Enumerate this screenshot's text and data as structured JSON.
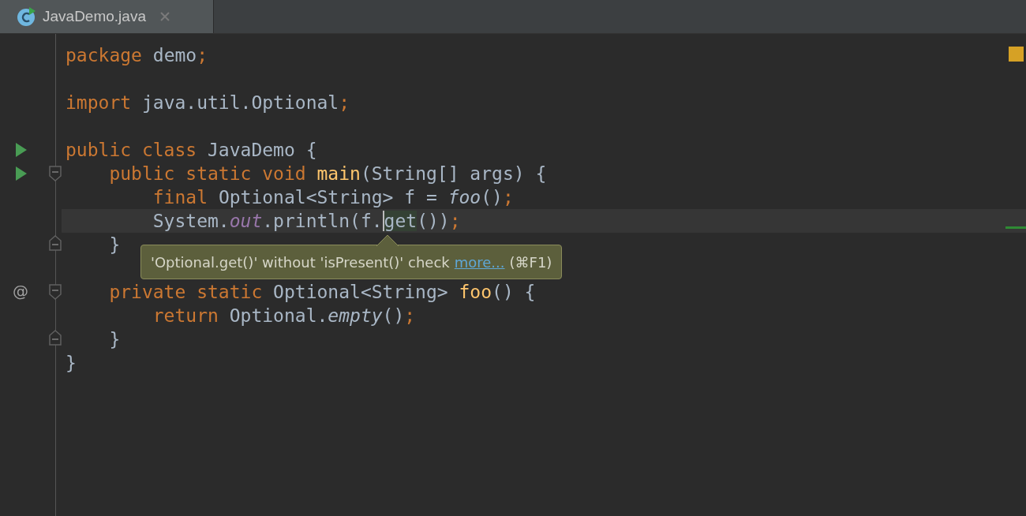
{
  "tab": {
    "title": "JavaDemo.java",
    "selected": true
  },
  "blocks": [
    {
      "lines": [
        {
          "tokens": [
            {
              "kind": "keyword",
              "text": "package "
            },
            {
              "kind": "plain",
              "text": "demo"
            },
            {
              "kind": "punct",
              "text": ";"
            }
          ]
        }
      ]
    },
    {
      "lines": [
        {
          "tokens": [
            {
              "kind": "keyword",
              "text": "import "
            },
            {
              "kind": "plain",
              "text": "java.util.Optional"
            },
            {
              "kind": "punct",
              "text": ";"
            }
          ]
        }
      ]
    },
    {
      "lines": [
        {
          "gutter": [
            {
              "kind": "run"
            }
          ],
          "tokens": [
            {
              "kind": "keyword",
              "text": "public class "
            },
            {
              "kind": "plain",
              "text": "JavaDemo {"
            }
          ]
        },
        {
          "gutter": [
            {
              "kind": "run"
            },
            {
              "kind": "fold-start"
            }
          ],
          "tokens": [
            {
              "kind": "keyword",
              "text": "    public static void "
            },
            {
              "kind": "method",
              "text": "main"
            },
            {
              "kind": "plain",
              "text": "(String[] args) {"
            }
          ]
        },
        {
          "tokens": [
            {
              "kind": "keyword",
              "text": "        final "
            },
            {
              "kind": "plain",
              "text": "Optional<String> f = "
            },
            {
              "kind": "italic",
              "text": "foo"
            },
            {
              "kind": "plain",
              "text": "()"
            },
            {
              "kind": "punct",
              "text": ";"
            }
          ]
        },
        {
          "tokens": [
            {
              "kind": "plain",
              "text": "        System."
            },
            {
              "kind": "field",
              "text": "out"
            },
            {
              "kind": "plain",
              "text": ".println(f."
            },
            {
              "kind": "highlight",
              "text": "get",
              "caret": true
            },
            {
              "kind": "plain",
              "text": "())"
            },
            {
              "kind": "punct",
              "text": ";"
            }
          ]
        },
        {
          "gutter": [
            {
              "kind": "fold-end"
            }
          ],
          "tokens": [
            {
              "kind": "plain",
              "text": "    }"
            }
          ]
        }
      ]
    },
    {
      "lines": [
        {
          "gutter": [
            {
              "kind": "symbol",
              "text": "@"
            },
            {
              "kind": "fold-start"
            }
          ],
          "tokens": [
            {
              "kind": "keyword",
              "text": "    private static "
            },
            {
              "kind": "plain",
              "text": "Optional<String> "
            },
            {
              "kind": "method",
              "text": "foo"
            },
            {
              "kind": "plain",
              "text": "() {"
            }
          ]
        },
        {
          "tokens": [
            {
              "kind": "keyword",
              "text": "        return "
            },
            {
              "kind": "plain",
              "text": "Optional."
            },
            {
              "kind": "italic",
              "text": "empty"
            },
            {
              "kind": "plain",
              "text": "()"
            },
            {
              "kind": "punct",
              "text": ";"
            }
          ]
        },
        {
          "gutter": [
            {
              "kind": "fold-end"
            }
          ],
          "tokens": [
            {
              "kind": "plain",
              "text": "    }"
            }
          ]
        },
        {
          "tokens": [
            {
              "kind": "plain",
              "text": "}"
            }
          ]
        }
      ]
    }
  ],
  "tooltip": {
    "message": "'Optional.get()' without 'isPresent()' check",
    "link": "more...",
    "shortcut": "(⌘F1)"
  }
}
